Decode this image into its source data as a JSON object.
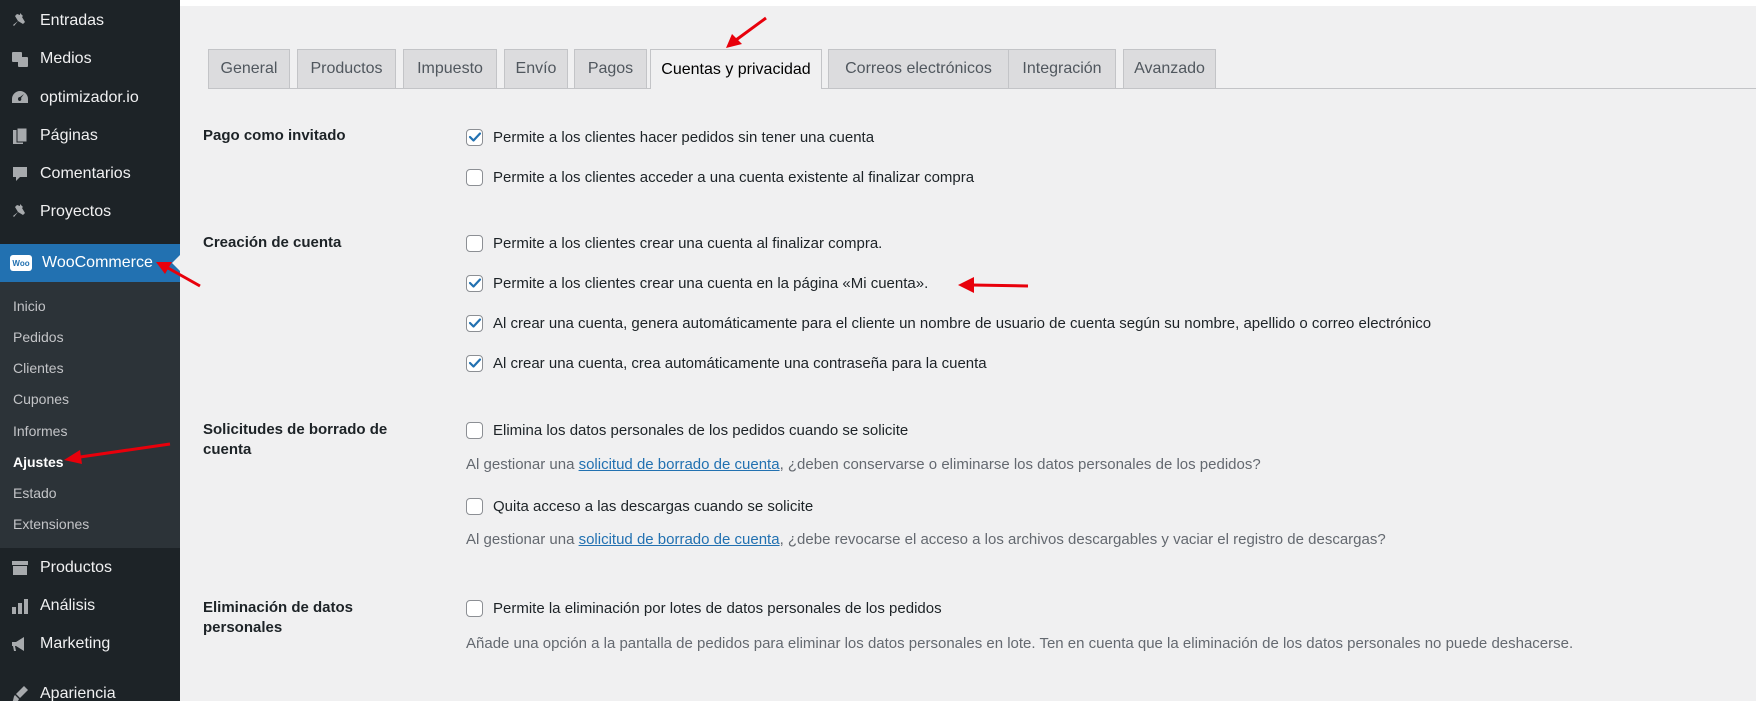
{
  "sidebar": {
    "items": [
      {
        "label": "Entradas",
        "icon": "pin-icon"
      },
      {
        "label": "Medios",
        "icon": "media-icon"
      },
      {
        "label": "optimizador.io",
        "icon": "gauge-icon"
      },
      {
        "label": "Páginas",
        "icon": "pages-icon"
      },
      {
        "label": "Comentarios",
        "icon": "comment-icon"
      },
      {
        "label": "Proyectos",
        "icon": "pin-icon"
      },
      {
        "label": "WooCommerce",
        "icon": "woo-icon"
      },
      {
        "label": "Productos",
        "icon": "archive-icon"
      },
      {
        "label": "Análisis",
        "icon": "bar-chart-icon"
      },
      {
        "label": "Marketing",
        "icon": "megaphone-icon"
      },
      {
        "label": "Apariencia",
        "icon": "brush-icon"
      }
    ],
    "woo_icon_text": "Woo",
    "submenu": [
      "Inicio",
      "Pedidos",
      "Clientes",
      "Cupones",
      "Informes",
      "Ajustes",
      "Estado",
      "Extensiones"
    ]
  },
  "tabs": [
    "General",
    "Productos",
    "Impuesto",
    "Envío",
    "Pagos",
    "Cuentas y privacidad",
    "Correos electrónicos",
    "Integración",
    "Avanzado"
  ],
  "active_tab": "Cuentas y privacidad",
  "sections": {
    "guest": {
      "label": "Pago como invitado",
      "opt1": "Permite a los clientes hacer pedidos sin tener una cuenta",
      "opt2": "Permite a los clientes acceder a una cuenta existente al finalizar compra"
    },
    "creation": {
      "label": "Creación de cuenta",
      "opt1": "Permite a los clientes crear una cuenta al finalizar compra.",
      "opt2": "Permite a los clientes crear una cuenta en la página «Mi cuenta».",
      "opt3": "Al crear una cuenta, genera automáticamente para el cliente un nombre de usuario de cuenta según su nombre, apellido o correo electrónico",
      "opt4": "Al crear una cuenta, crea automáticamente una contraseña para la cuenta"
    },
    "erasure": {
      "label": "Solicitudes de borrado de cuenta",
      "opt1": "Elimina los datos personales de los pedidos cuando se solicite",
      "desc1_pre": "Al gestionar una ",
      "link": "solicitud de borrado de cuenta",
      "desc1_post": ", ¿deben conservarse o eliminarse los datos personales de los pedidos?",
      "opt2": "Quita acceso a las descargas cuando se solicite",
      "desc2_pre": "Al gestionar una ",
      "desc2_post": ", ¿debe revocarse el acceso a los archivos descargables y vaciar el registro de descargas?"
    },
    "removal": {
      "label": "Eliminación de datos personales",
      "opt1": "Permite la eliminación por lotes de datos personales de los pedidos",
      "desc": "Añade una opción a la pantalla de pedidos para eliminar los datos personales en lote. Ten en cuenta que la eliminación de los datos personales no puede deshacerse."
    }
  },
  "checked": {
    "guest_opt1": true,
    "guest_opt2": false,
    "creation_opt1": false,
    "creation_opt2": true,
    "creation_opt3": true,
    "creation_opt4": true,
    "erasure_opt1": false,
    "erasure_opt2": false,
    "removal_opt1": false
  },
  "colors": {
    "accent": "#2271b1",
    "arrow": "#e8000b",
    "sidebar_bg": "#1d2327"
  }
}
